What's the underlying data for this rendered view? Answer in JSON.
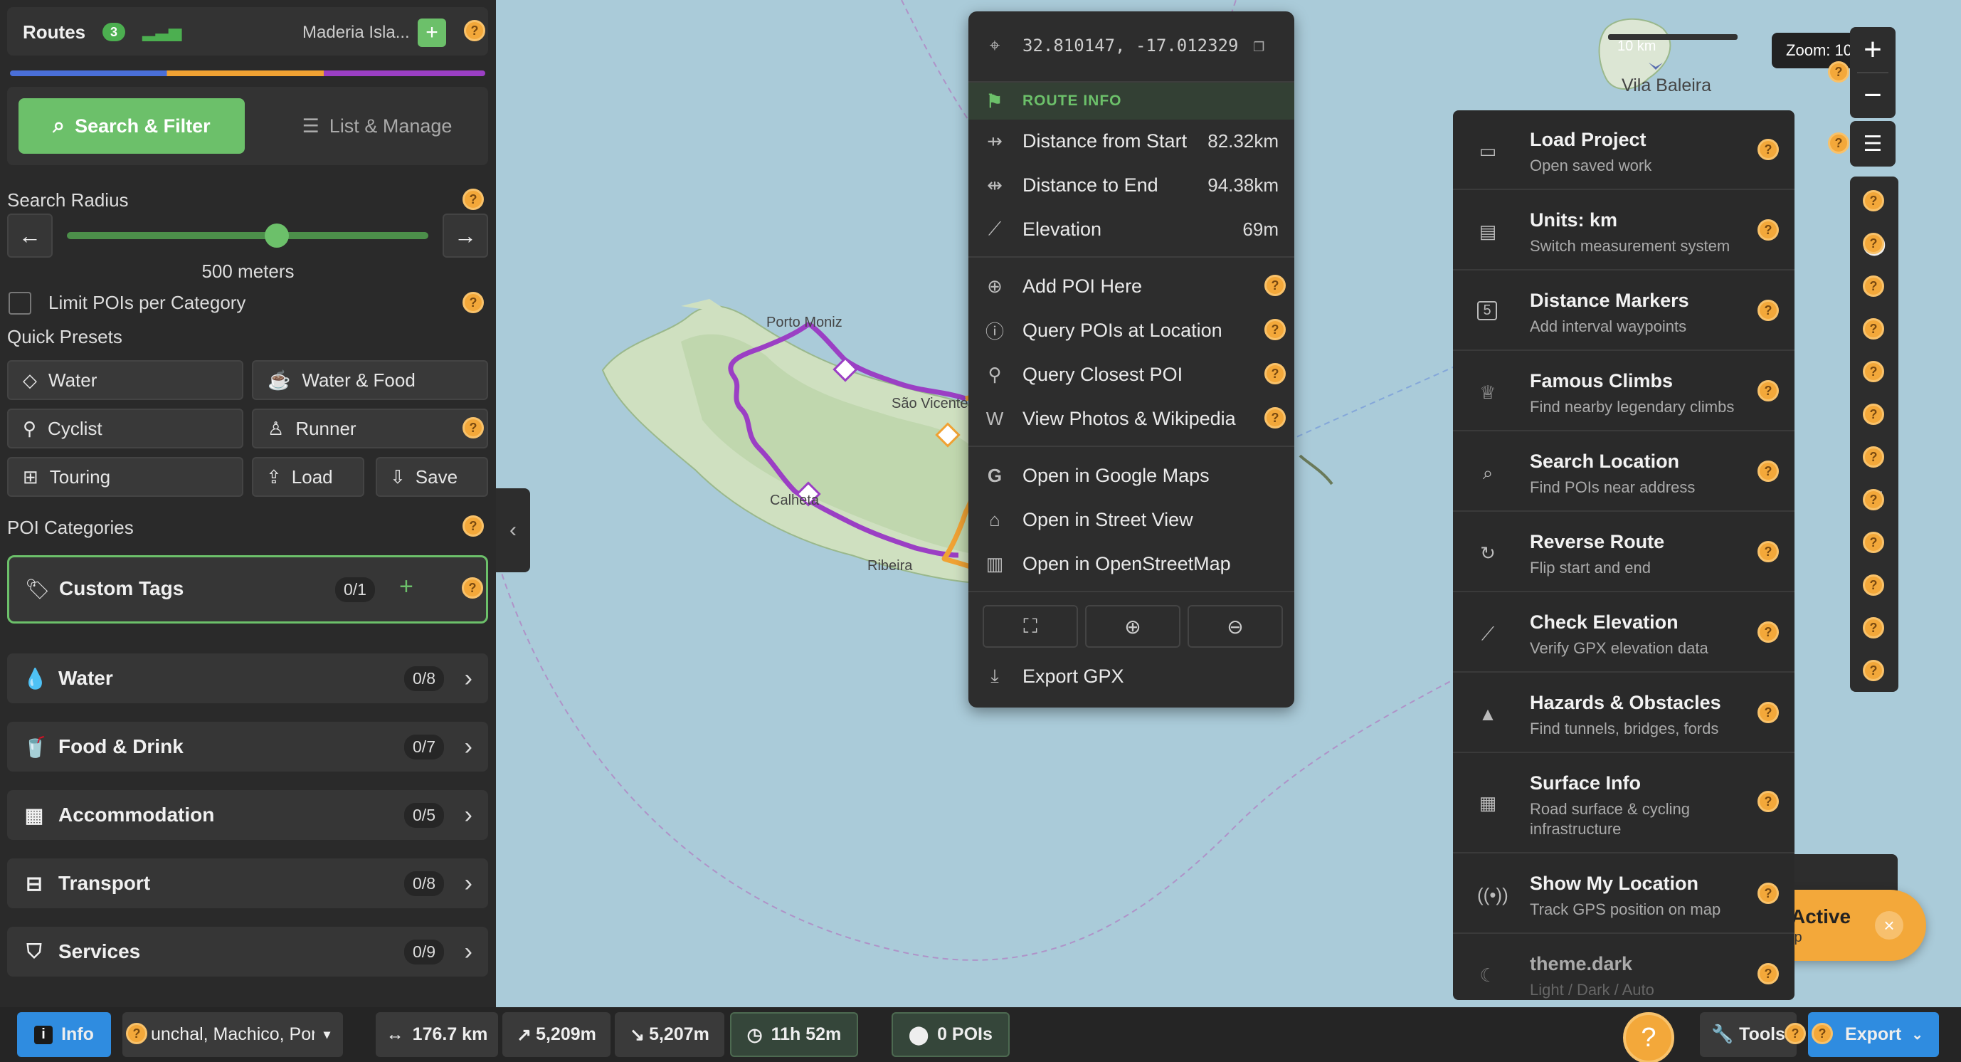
{
  "sidebar": {
    "routes_label": "Routes",
    "routes_count": "3",
    "route_name": "Maderia Isla...",
    "tabs": {
      "search": "Search & Filter",
      "list": "List & Manage"
    },
    "search_radius_label": "Search Radius",
    "radius_value": "500 meters",
    "radius_fraction": 0.58,
    "limit_label": "Limit POIs per Category",
    "quick_presets_label": "Quick Presets",
    "presets": {
      "water": "Water",
      "water_food": "Water & Food",
      "cyclist": "Cyclist",
      "runner": "Runner",
      "touring": "Touring",
      "load": "Load",
      "save": "Save"
    },
    "poi_categories_label": "POI Categories",
    "custom_tags": {
      "label": "Custom Tags",
      "count": "0/1"
    },
    "categories": [
      {
        "label": "Water",
        "count": "0/8"
      },
      {
        "label": "Food & Drink",
        "count": "0/7"
      },
      {
        "label": "Accommodation",
        "count": "0/5"
      },
      {
        "label": "Transport",
        "count": "0/8"
      },
      {
        "label": "Services",
        "count": "0/9"
      }
    ]
  },
  "map": {
    "labels": {
      "porto_moniz": "Porto Moniz",
      "sao_vicente": "São Vicente",
      "calheta": "Calheta",
      "ribeira": "Ribeira",
      "vila_baleira": "Vila Baleira",
      "scale": "10 km"
    },
    "zoom": "Zoom: 10"
  },
  "context_menu": {
    "coords": "32.810147, -17.012329",
    "section": "ROUTE INFO",
    "distance_start": {
      "label": "Distance from Start",
      "value": "82.32km"
    },
    "distance_end": {
      "label": "Distance to End",
      "value": "94.38km"
    },
    "elevation": {
      "label": "Elevation",
      "value": "69m"
    },
    "add_poi": "Add POI Here",
    "query_pois": "Query POIs at Location",
    "query_closest": "Query Closest POI",
    "view_photos": "View Photos & Wikipedia",
    "google_maps": "Open in Google Maps",
    "street_view": "Open in Street View",
    "osm": "Open in OpenStreetMap",
    "export_gpx": "Export GPX"
  },
  "tools_menu": [
    {
      "title": "Load Project",
      "sub": "Open saved work",
      "icon": "folder-icon"
    },
    {
      "title": "Units: km",
      "sub": "Switch measurement system",
      "icon": "ruler-icon"
    },
    {
      "title": "Distance Markers",
      "sub": "Add interval waypoints",
      "icon": "marker-5-icon"
    },
    {
      "title": "Famous Climbs",
      "sub": "Find nearby legendary climbs",
      "icon": "trophy-icon"
    },
    {
      "title": "Search Location",
      "sub": "Find POIs near address",
      "icon": "search-icon"
    },
    {
      "title": "Reverse Route",
      "sub": "Flip start and end",
      "icon": "reverse-icon"
    },
    {
      "title": "Check Elevation",
      "sub": "Verify GPX elevation data",
      "icon": "chart-icon"
    },
    {
      "title": "Hazards & Obstacles",
      "sub": "Find tunnels, bridges, fords",
      "icon": "cone-icon"
    },
    {
      "title": "Surface Info",
      "sub": "Road surface & cycling infrastructure",
      "icon": "surface-icon"
    },
    {
      "title": "Show My Location",
      "sub": "Track GPS position on map",
      "icon": "gps-icon"
    },
    {
      "title": "theme.dark",
      "sub": "Light / Dark / Auto",
      "icon": "moon-icon"
    }
  ],
  "toast": {
    "title": "Active",
    "sub": "lp"
  },
  "bottom_bar": {
    "info": "Info",
    "location_select": "unchal, Machico, Por",
    "distance": "176.7 km",
    "ascent": "5,209m",
    "descent": "5,207m",
    "time": "11h 52m",
    "pois": "0 POIs",
    "tools": "Tools",
    "export": "Export"
  },
  "colors": {
    "accent_green": "#6cc06a",
    "route_purple": "#9b3fc4",
    "route_orange": "#f0a233",
    "help_orange": "#f3a83a",
    "export_blue": "#2f8ce0"
  }
}
